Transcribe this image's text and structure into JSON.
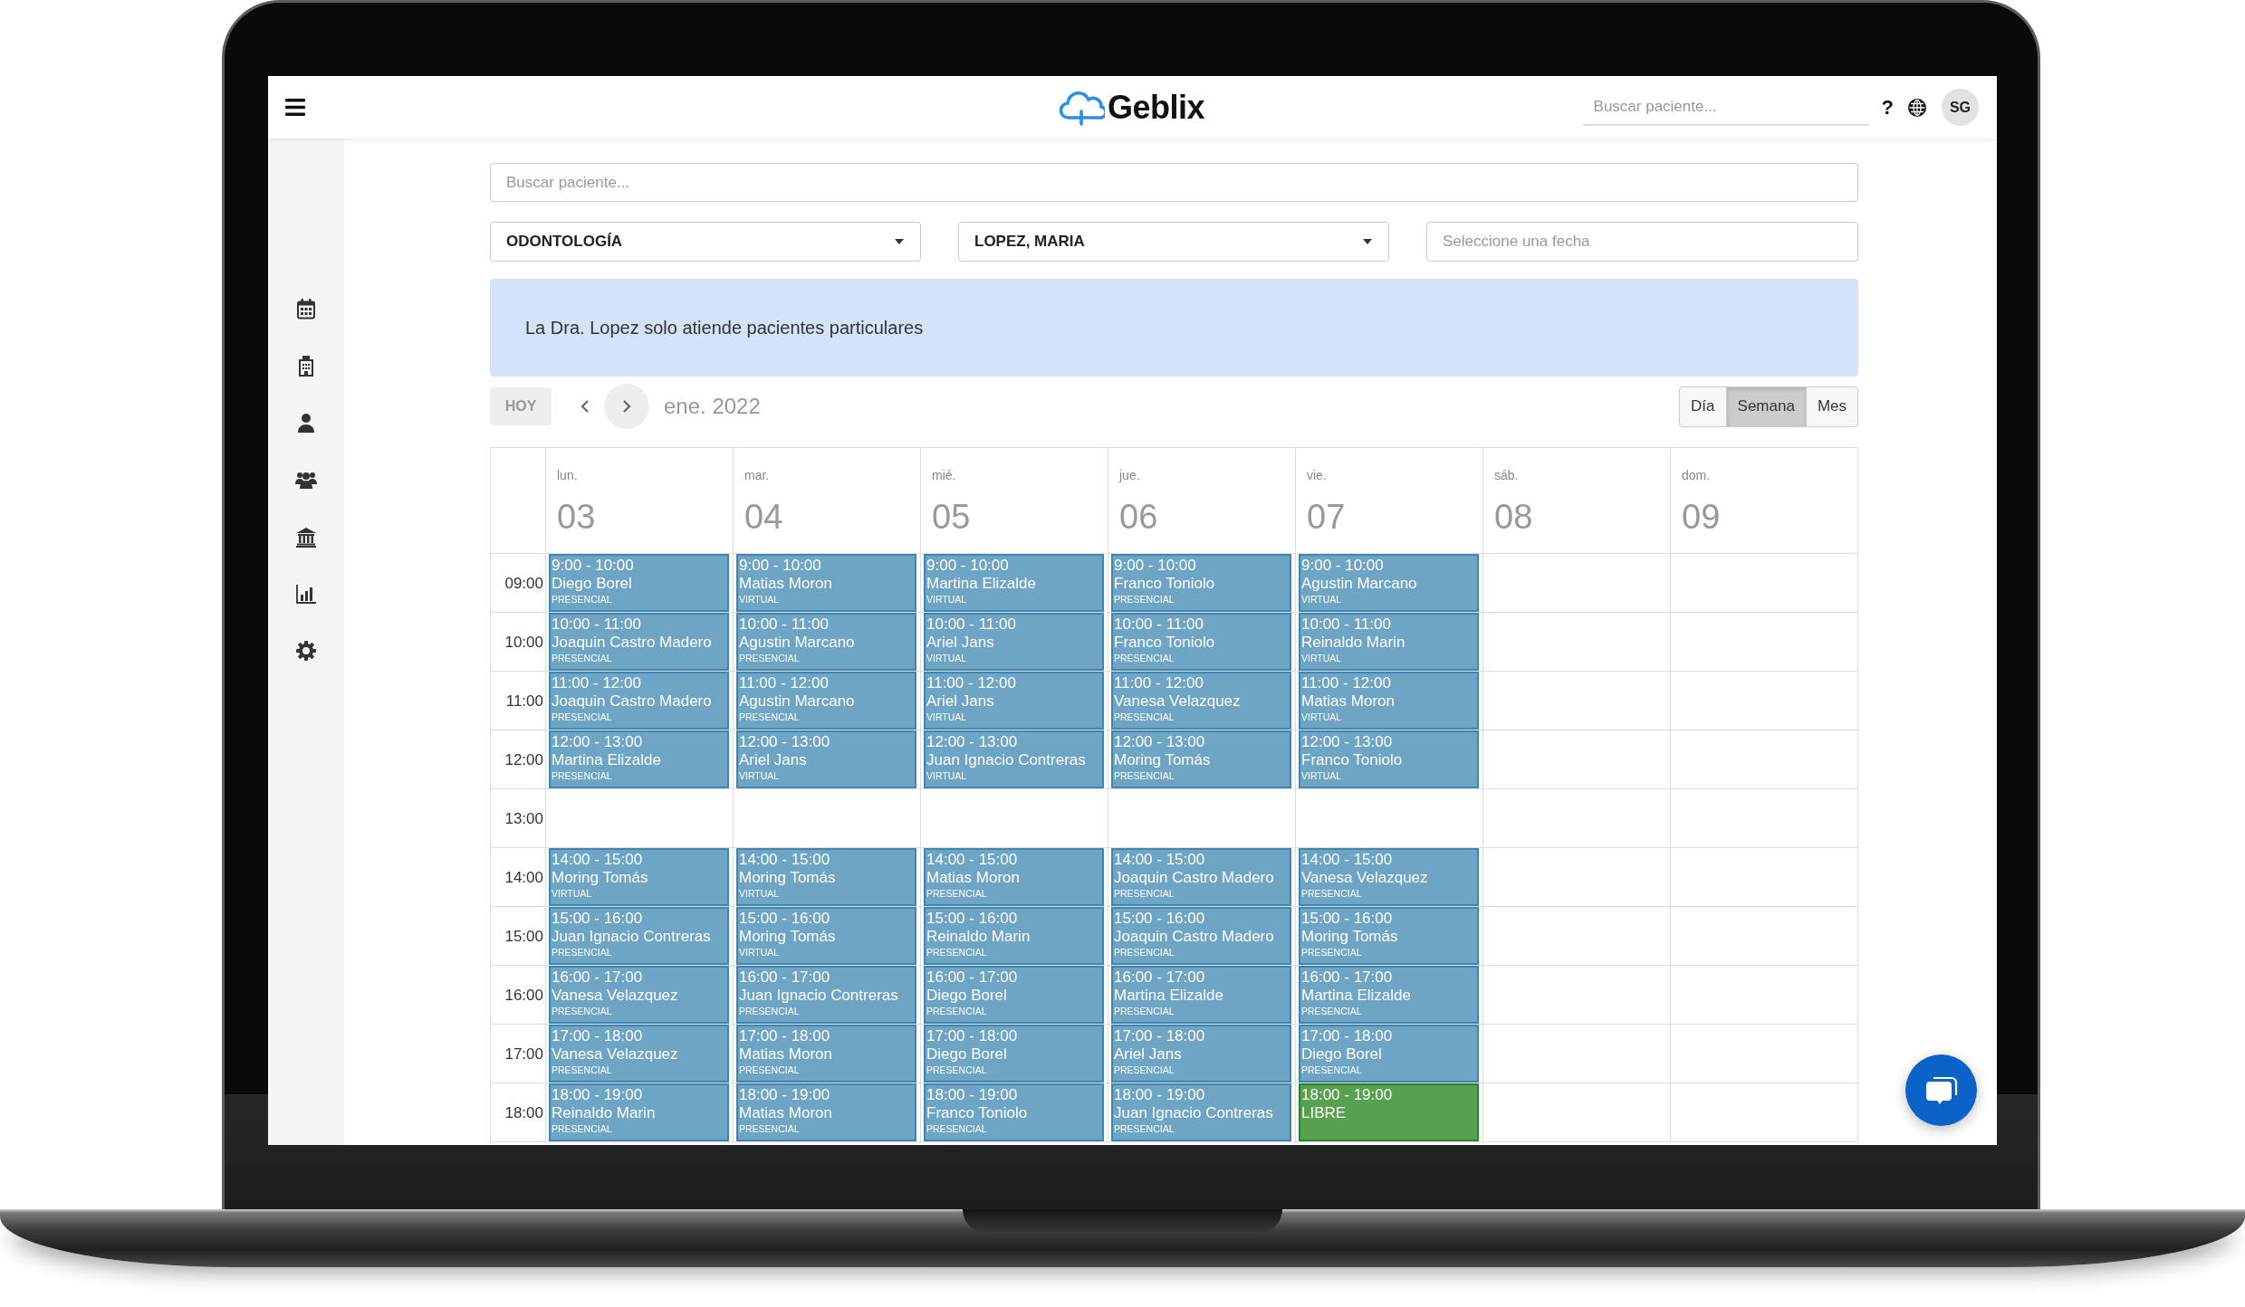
{
  "top_bar": {
    "logo": "Geblix",
    "search": {
      "placeholder": "Buscar paciente..."
    },
    "help": "?",
    "avatar": "SG"
  },
  "patient_search": {
    "placeholder": "Buscar paciente..."
  },
  "filters": [
    {
      "kind": "select",
      "value": "ODONTOLOGÍA"
    },
    {
      "kind": "select",
      "value": "LOPEZ, MARIA"
    },
    {
      "kind": "date",
      "placeholder": "Seleccione una fecha"
    }
  ],
  "notice": "La Dra. Lopez solo atiende pacientes particulares",
  "toolbar": {
    "today": {
      "label": "HOY",
      "disabled": true
    },
    "period": "ene. 2022",
    "views": [
      {
        "label": "Día",
        "selected": false
      },
      {
        "label": "Semana",
        "selected": true
      },
      {
        "label": "Mes",
        "selected": false
      }
    ]
  },
  "calendar": {
    "days": [
      {
        "weekday": "lun.",
        "date": "03"
      },
      {
        "weekday": "mar.",
        "date": "04"
      },
      {
        "weekday": "mié.",
        "date": "05"
      },
      {
        "weekday": "jue.",
        "date": "06"
      },
      {
        "weekday": "vie.",
        "date": "07"
      },
      {
        "weekday": "sáb.",
        "date": "08"
      },
      {
        "weekday": "dom.",
        "date": "09"
      }
    ],
    "rows": [
      {
        "time": "09:00",
        "events": [
          {
            "kind": "booked",
            "time": "9:00 - 10:00",
            "patient": "Diego Borel",
            "modality": "PRESENCIAL"
          },
          {
            "kind": "booked",
            "time": "9:00 - 10:00",
            "patient": "Matias Moron",
            "modality": "VIRTUAL"
          },
          {
            "kind": "booked",
            "time": "9:00 - 10:00",
            "patient": "Martina Elizalde",
            "modality": "VIRTUAL"
          },
          {
            "kind": "booked",
            "time": "9:00 - 10:00",
            "patient": "Franco Toniolo",
            "modality": "PRESENCIAL"
          },
          {
            "kind": "booked",
            "time": "9:00 - 10:00",
            "patient": "Agustin Marcano",
            "modality": "VIRTUAL"
          }
        ]
      },
      {
        "time": "10:00",
        "events": [
          {
            "kind": "booked",
            "time": "10:00 - 11:00",
            "patient": "Joaquin Castro Madero",
            "modality": "PRESENCIAL"
          },
          {
            "kind": "booked",
            "time": "10:00 - 11:00",
            "patient": "Agustin Marcano",
            "modality": "PRESENCIAL"
          },
          {
            "kind": "booked",
            "time": "10:00 - 11:00",
            "patient": "Ariel Jans",
            "modality": "VIRTUAL"
          },
          {
            "kind": "booked",
            "time": "10:00 - 11:00",
            "patient": "Franco Toniolo",
            "modality": "PRESENCIAL"
          },
          {
            "kind": "booked",
            "time": "10:00 - 11:00",
            "patient": "Reinaldo Marin",
            "modality": "VIRTUAL"
          }
        ]
      },
      {
        "time": "11:00",
        "events": [
          {
            "kind": "booked",
            "time": "11:00 - 12:00",
            "patient": "Joaquin Castro Madero",
            "modality": "PRESENCIAL"
          },
          {
            "kind": "booked",
            "time": "11:00 - 12:00",
            "patient": "Agustin Marcano",
            "modality": "PRESENCIAL"
          },
          {
            "kind": "booked",
            "time": "11:00 - 12:00",
            "patient": "Ariel Jans",
            "modality": "VIRTUAL"
          },
          {
            "kind": "booked",
            "time": "11:00 - 12:00",
            "patient": "Vanesa Velazquez",
            "modality": "PRESENCIAL"
          },
          {
            "kind": "booked",
            "time": "11:00 - 12:00",
            "patient": "Matias Moron",
            "modality": "VIRTUAL"
          }
        ]
      },
      {
        "time": "12:00",
        "events": [
          {
            "kind": "booked",
            "time": "12:00 - 13:00",
            "patient": "Martina Elizalde",
            "modality": "PRESENCIAL"
          },
          {
            "kind": "booked",
            "time": "12:00 - 13:00",
            "patient": "Ariel Jans",
            "modality": "VIRTUAL"
          },
          {
            "kind": "booked",
            "time": "12:00 - 13:00",
            "patient": "Juan Ignacio Contreras",
            "modality": "VIRTUAL"
          },
          {
            "kind": "booked",
            "time": "12:00 - 13:00",
            "patient": "Moring Tomás",
            "modality": "PRESENCIAL"
          },
          {
            "kind": "booked",
            "time": "12:00 - 13:00",
            "patient": "Franco Toniolo",
            "modality": "VIRTUAL"
          }
        ]
      },
      {
        "time": "13:00"
      },
      {
        "time": "14:00",
        "events": [
          {
            "kind": "booked",
            "time": "14:00 - 15:00",
            "patient": "Moring Tomás",
            "modality": "VIRTUAL"
          },
          {
            "kind": "booked",
            "time": "14:00 - 15:00",
            "patient": "Moring Tomás",
            "modality": "VIRTUAL"
          },
          {
            "kind": "booked",
            "time": "14:00 - 15:00",
            "patient": "Matias Moron",
            "modality": "PRESENCIAL"
          },
          {
            "kind": "booked",
            "time": "14:00 - 15:00",
            "patient": "Joaquin Castro Madero",
            "modality": "PRESENCIAL"
          },
          {
            "kind": "booked",
            "time": "14:00 - 15:00",
            "patient": "Vanesa Velazquez",
            "modality": "PRESENCIAL"
          }
        ]
      },
      {
        "time": "15:00",
        "events": [
          {
            "kind": "booked",
            "time": "15:00 - 16:00",
            "patient": "Juan Ignacio Contreras",
            "modality": "PRESENCIAL"
          },
          {
            "kind": "booked",
            "time": "15:00 - 16:00",
            "patient": "Moring Tomás",
            "modality": "VIRTUAL"
          },
          {
            "kind": "booked",
            "time": "15:00 - 16:00",
            "patient": "Reinaldo Marin",
            "modality": "PRESENCIAL"
          },
          {
            "kind": "booked",
            "time": "15:00 - 16:00",
            "patient": "Joaquin Castro Madero",
            "modality": "PRESENCIAL"
          },
          {
            "kind": "booked",
            "time": "15:00 - 16:00",
            "patient": "Moring Tomás",
            "modality": "PRESENCIAL"
          }
        ]
      },
      {
        "time": "16:00",
        "events": [
          {
            "kind": "booked",
            "time": "16:00 - 17:00",
            "patient": "Vanesa Velazquez",
            "modality": "PRESENCIAL"
          },
          {
            "kind": "booked",
            "time": "16:00 - 17:00",
            "patient": "Juan Ignacio Contreras",
            "modality": "PRESENCIAL"
          },
          {
            "kind": "booked",
            "time": "16:00 - 17:00",
            "patient": "Diego Borel",
            "modality": "PRESENCIAL"
          },
          {
            "kind": "booked",
            "time": "16:00 - 17:00",
            "patient": "Martina Elizalde",
            "modality": "PRESENCIAL"
          },
          {
            "kind": "booked",
            "time": "16:00 - 17:00",
            "patient": "Martina Elizalde",
            "modality": "PRESENCIAL"
          }
        ]
      },
      {
        "time": "17:00",
        "events": [
          {
            "kind": "booked",
            "time": "17:00 - 18:00",
            "patient": "Vanesa Velazquez",
            "modality": "PRESENCIAL"
          },
          {
            "kind": "booked",
            "time": "17:00 - 18:00",
            "patient": "Matias Moron",
            "modality": "PRESENCIAL"
          },
          {
            "kind": "booked",
            "time": "17:00 - 18:00",
            "patient": "Diego Borel",
            "modality": "PRESENCIAL"
          },
          {
            "kind": "booked",
            "time": "17:00 - 18:00",
            "patient": "Ariel Jans",
            "modality": "PRESENCIAL"
          },
          {
            "kind": "booked",
            "time": "17:00 - 18:00",
            "patient": "Diego Borel",
            "modality": "PRESENCIAL"
          }
        ]
      },
      {
        "time": "18:00",
        "events": [
          {
            "kind": "booked",
            "time": "18:00 - 19:00",
            "patient": "Reinaldo Marin",
            "modality": "PRESENCIAL"
          },
          {
            "kind": "booked",
            "time": "18:00 - 19:00",
            "patient": "Matias Moron",
            "modality": "PRESENCIAL"
          },
          {
            "kind": "booked",
            "time": "18:00 - 19:00",
            "patient": "Franco Toniolo",
            "modality": "PRESENCIAL"
          },
          {
            "kind": "booked",
            "time": "18:00 - 19:00",
            "patient": "Juan Ignacio Contreras",
            "modality": "PRESENCIAL"
          },
          {
            "kind": "free",
            "time": "18:00 - 19:00",
            "label": "LIBRE"
          }
        ]
      }
    ]
  }
}
